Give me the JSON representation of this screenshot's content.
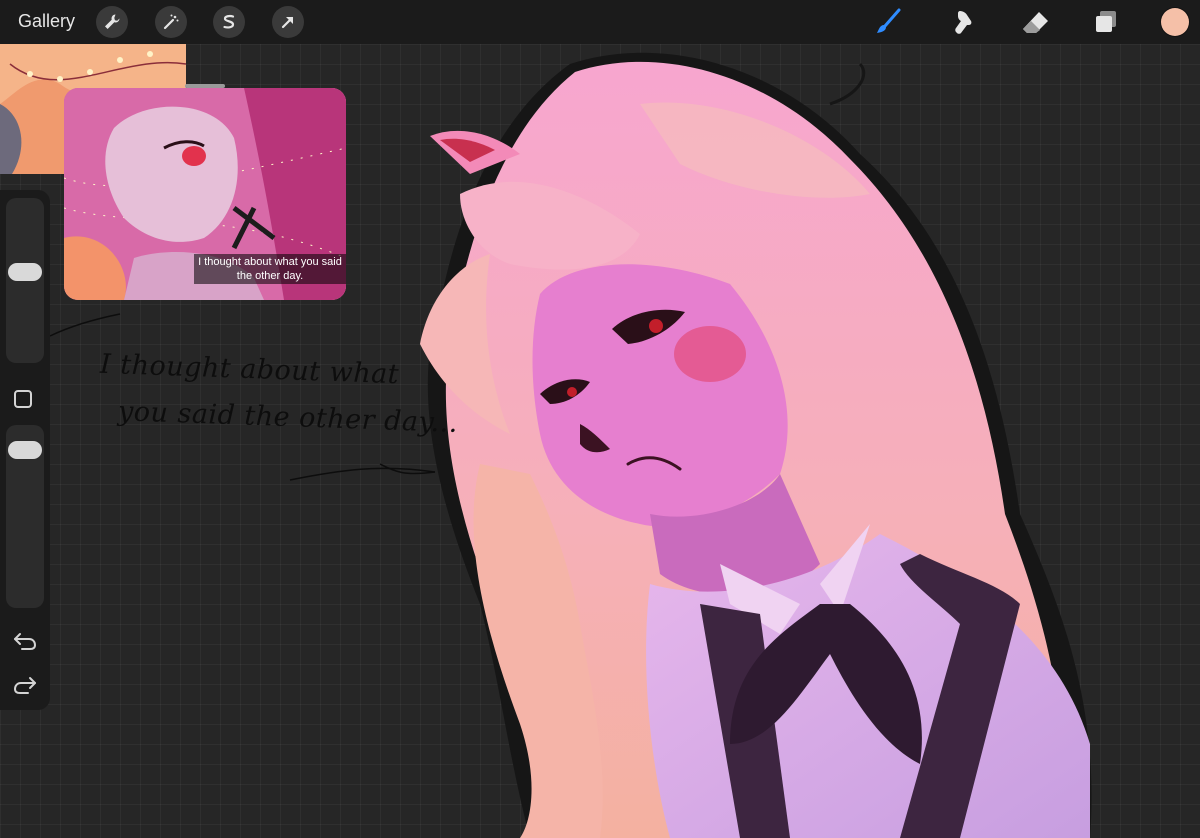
{
  "topbar": {
    "gallery_label": "Gallery",
    "left_tools": [
      {
        "name": "wrench-icon"
      },
      {
        "name": "magic-wand-icon"
      },
      {
        "name": "selection-icon"
      },
      {
        "name": "transform-arrow-icon"
      }
    ],
    "right_tools": [
      {
        "name": "brush-icon",
        "active_color": "#2f8cff"
      },
      {
        "name": "smudge-icon"
      },
      {
        "name": "eraser-icon"
      },
      {
        "name": "layers-icon"
      }
    ],
    "current_color": "#f5c0a8"
  },
  "sidebar": {
    "brush_size_slider": "brush-size",
    "opacity_slider": "opacity"
  },
  "reference": {
    "subtitle_line1": "I thought about what you said",
    "subtitle_line2": "the other day."
  },
  "canvas_text": {
    "line1": "I thought about what",
    "line2": "you said the other day..."
  },
  "colors": {
    "background": "#262626",
    "topbar": "#1b1b1b",
    "hair": "#f4a0c8",
    "skin": "#e87fcf",
    "shirt": "#d8a8e6",
    "vest": "#3d2540"
  }
}
